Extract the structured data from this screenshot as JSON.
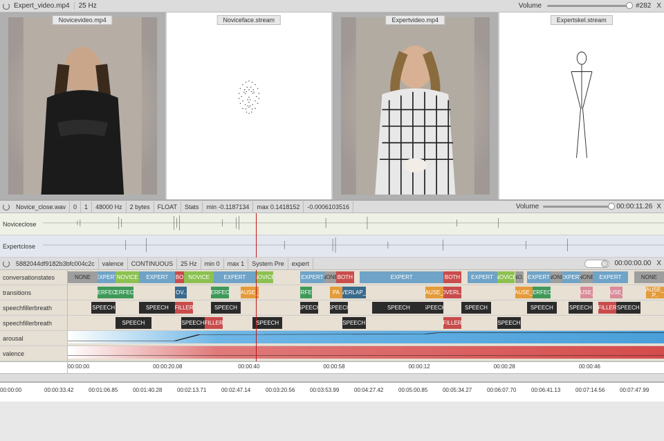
{
  "topbar": {
    "title": "Expert_video.mp4",
    "fps": "25 Hz",
    "volume_label": "Volume",
    "frame_index": "#282",
    "close_label": "X"
  },
  "panels": [
    {
      "label": "Novicevideo.mp4"
    },
    {
      "label": "Noviceface.stream"
    },
    {
      "label": "Expertvideo.mp4"
    },
    {
      "label": "Expertskel.stream"
    }
  ],
  "audio": {
    "file": "Novice_close.wav",
    "channel": "0",
    "pipe": "1",
    "rate": "48000 Hz",
    "bytes": "2 bytes",
    "format": "FLOAT",
    "stats": "Stats",
    "min": "min -0.1187134",
    "max": "max 0.1418152",
    "extra": "-0.0006103516",
    "volume_label": "Volume",
    "time": "00:00:11.26",
    "close": "X",
    "rows": [
      {
        "name": "Noviceclose"
      },
      {
        "name": "Expertclose"
      }
    ]
  },
  "anno": {
    "id": "5882044df9182b3bfc004c2c",
    "dim": "valence",
    "type": "CONTINUOUS",
    "fps": "25 Hz",
    "min": "min 0",
    "max": "max 1",
    "scheme": "System Pre",
    "set": "expert",
    "time": "00:00:00.00",
    "close": "X",
    "tracks": [
      {
        "name": "conversationstates",
        "segs": [
          {
            "l": 0,
            "w": 5,
            "c": "gray",
            "t": "NONE"
          },
          {
            "l": 5,
            "w": 3,
            "c": "blue",
            "t": "EXPERT"
          },
          {
            "l": 8,
            "w": 4,
            "c": "green",
            "t": "NOVICE"
          },
          {
            "l": 12,
            "w": 6,
            "c": "blue",
            "t": "EXPERT"
          },
          {
            "l": 18,
            "w": 1.5,
            "c": "red",
            "t": "BO"
          },
          {
            "l": 19.5,
            "w": 5,
            "c": "green",
            "t": "NOVICE"
          },
          {
            "l": 24.5,
            "w": 7,
            "c": "blue",
            "t": "EXPERT"
          },
          {
            "l": 31.5,
            "w": 3,
            "c": "green",
            "t": "NOVICE"
          },
          {
            "l": 39,
            "w": 4,
            "c": "blue",
            "t": "EXPERT"
          },
          {
            "l": 43,
            "w": 2,
            "c": "gray",
            "t": "NONE"
          },
          {
            "l": 45,
            "w": 3,
            "c": "red",
            "t": "BOTH"
          },
          {
            "l": 49,
            "w": 14,
            "c": "blue",
            "t": "EXPERT"
          },
          {
            "l": 63,
            "w": 3,
            "c": "red",
            "t": "BOTH"
          },
          {
            "l": 67,
            "w": 5,
            "c": "blue",
            "t": "EXPERT"
          },
          {
            "l": 72,
            "w": 3,
            "c": "green",
            "t": "NOVICE"
          },
          {
            "l": 75,
            "w": 1.5,
            "c": "gray",
            "t": "NO.."
          },
          {
            "l": 77,
            "w": 4,
            "c": "blue",
            "t": "EXPERT"
          },
          {
            "l": 81,
            "w": 2,
            "c": "gray",
            "t": "NONE"
          },
          {
            "l": 83,
            "w": 3,
            "c": "blue",
            "t": "EXPERT"
          },
          {
            "l": 86,
            "w": 2,
            "c": "gray",
            "t": "NONE"
          },
          {
            "l": 88,
            "w": 6,
            "c": "blue",
            "t": "EXPERT"
          },
          {
            "l": 95,
            "w": 5,
            "c": "gray",
            "t": "NONE"
          }
        ]
      },
      {
        "name": "transitions",
        "segs": [
          {
            "l": 5,
            "w": 3,
            "c": "dgreen",
            "t": "PERFECT"
          },
          {
            "l": 8,
            "w": 3,
            "c": "dgreen",
            "t": "PERFECT"
          },
          {
            "l": 18,
            "w": 2,
            "c": "darkblue",
            "t": "OV.."
          },
          {
            "l": 24,
            "w": 3,
            "c": "dgreen",
            "t": "PERFECT"
          },
          {
            "l": 29,
            "w": 3,
            "c": "orange",
            "t": "PAUSE_B"
          },
          {
            "l": 39,
            "w": 2,
            "c": "dgreen",
            "t": "PERFECT"
          },
          {
            "l": 44,
            "w": 2,
            "c": "orange",
            "t": "PA"
          },
          {
            "l": 46,
            "w": 4,
            "c": "darkblue",
            "t": "OVERLAP_W"
          },
          {
            "l": 60,
            "w": 3,
            "c": "orange",
            "t": "PAUSE_B"
          },
          {
            "l": 63,
            "w": 3,
            "c": "red",
            "t": "OVERL.."
          },
          {
            "l": 75,
            "w": 3,
            "c": "orange",
            "t": "PAUSE_B"
          },
          {
            "l": 78,
            "w": 3,
            "c": "dgreen",
            "t": "PERFECT"
          },
          {
            "l": 86,
            "w": 2,
            "c": "pink",
            "t": "PAUSE_W"
          },
          {
            "l": 91,
            "w": 2,
            "c": "pink",
            "t": "PAUSE_W"
          },
          {
            "l": 97,
            "w": 3,
            "c": "orange",
            "t": "PAUSE_B P.."
          }
        ]
      },
      {
        "name": "speechfillerbreath",
        "segs": [
          {
            "l": 4,
            "w": 4,
            "c": "black",
            "t": "SPEECH"
          },
          {
            "l": 12,
            "w": 6,
            "c": "black",
            "t": "SPEECH"
          },
          {
            "l": 18,
            "w": 3,
            "c": "red",
            "t": "FILLER"
          },
          {
            "l": 24,
            "w": 5,
            "c": "black",
            "t": "SPEECH"
          },
          {
            "l": 39,
            "w": 3,
            "c": "black",
            "t": "SPEECH"
          },
          {
            "l": 44,
            "w": 3,
            "c": "black",
            "t": "SPEECH"
          },
          {
            "l": 51,
            "w": 9,
            "c": "black",
            "t": "SPEECH"
          },
          {
            "l": 60,
            "w": 3,
            "c": "black",
            "t": "SPEECH"
          },
          {
            "l": 66,
            "w": 5,
            "c": "black",
            "t": "SPEECH"
          },
          {
            "l": 77,
            "w": 5,
            "c": "black",
            "t": "SPEECH"
          },
          {
            "l": 84,
            "w": 4,
            "c": "black",
            "t": "SPEECH"
          },
          {
            "l": 89,
            "w": 3,
            "c": "red",
            "t": "FILLER"
          },
          {
            "l": 92,
            "w": 4,
            "c": "black",
            "t": "SPEECH"
          }
        ]
      },
      {
        "name": "speechfillerbreath",
        "segs": [
          {
            "l": 8,
            "w": 6,
            "c": "black",
            "t": "SPEECH"
          },
          {
            "l": 19,
            "w": 4,
            "c": "black",
            "t": "SPEECH"
          },
          {
            "l": 23,
            "w": 3,
            "c": "red",
            "t": "FILLER"
          },
          {
            "l": 31,
            "w": 5,
            "c": "black",
            "t": "SPEECH"
          },
          {
            "l": 46,
            "w": 4,
            "c": "black",
            "t": "SPEECH"
          },
          {
            "l": 63,
            "w": 3,
            "c": "red",
            "t": "FILLER"
          },
          {
            "l": 72,
            "w": 4,
            "c": "black",
            "t": "SPEECH"
          }
        ]
      },
      {
        "name": "arousal",
        "kind": "aro"
      },
      {
        "name": "valence",
        "kind": "val"
      }
    ]
  },
  "ruler1": [
    "00:00:00",
    "00:00:20.08",
    "00:00:40",
    "00:00:58",
    "00:00:12",
    "00:00:28",
    "00:00:46"
  ],
  "ruler2": [
    "00:00:00",
    "00:00:33.42",
    "00:01:06.85",
    "00:01:40.28",
    "00:02:13.71",
    "00:02:47.14",
    "00:03:20.56",
    "00:03:53.99",
    "00:04:27.42",
    "00:05:00.85",
    "00:05:34.27",
    "00:06:07.70",
    "00:06:41.13",
    "00:07:14.56",
    "00:07:47.99"
  ]
}
